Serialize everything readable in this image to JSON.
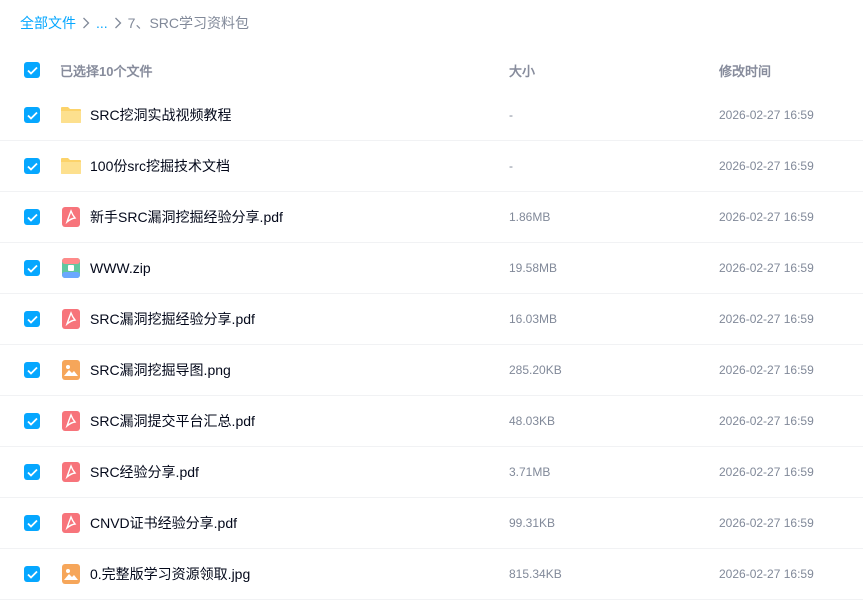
{
  "breadcrumb": {
    "root": "全部文件",
    "ellipsis": "...",
    "current": "7、SRC学习资料包"
  },
  "header": {
    "selection": "已选择10个文件",
    "size": "大小",
    "modified": "修改时间"
  },
  "colors": {
    "accent": "#06a7ff",
    "folder": "#fcd36a",
    "pdf": "#f7747b",
    "image": "#f6a65a"
  },
  "files": [
    {
      "name": "SRC挖洞实战视频教程",
      "size": "-",
      "modified": "2026-02-27 16:59",
      "icon": "folder-icon"
    },
    {
      "name": "100份src挖掘技术文档",
      "size": "-",
      "modified": "2026-02-27 16:59",
      "icon": "folder-icon"
    },
    {
      "name": "新手SRC漏洞挖掘经验分享.pdf",
      "size": "1.86MB",
      "modified": "2026-02-27 16:59",
      "icon": "pdf-icon"
    },
    {
      "name": "WWW.zip",
      "size": "19.58MB",
      "modified": "2026-02-27 16:59",
      "icon": "zip-icon"
    },
    {
      "name": "SRC漏洞挖掘经验分享.pdf",
      "size": "16.03MB",
      "modified": "2026-02-27 16:59",
      "icon": "pdf-icon"
    },
    {
      "name": "SRC漏洞挖掘导图.png",
      "size": "285.20KB",
      "modified": "2026-02-27 16:59",
      "icon": "image-icon"
    },
    {
      "name": "SRC漏洞提交平台汇总.pdf",
      "size": "48.03KB",
      "modified": "2026-02-27 16:59",
      "icon": "pdf-icon"
    },
    {
      "name": "SRC经验分享.pdf",
      "size": "3.71MB",
      "modified": "2026-02-27 16:59",
      "icon": "pdf-icon"
    },
    {
      "name": "CNVD证书经验分享.pdf",
      "size": "99.31KB",
      "modified": "2026-02-27 16:59",
      "icon": "pdf-icon"
    },
    {
      "name": "0.完整版学习资源领取.jpg",
      "size": "815.34KB",
      "modified": "2026-02-27 16:59",
      "icon": "image-icon"
    }
  ]
}
